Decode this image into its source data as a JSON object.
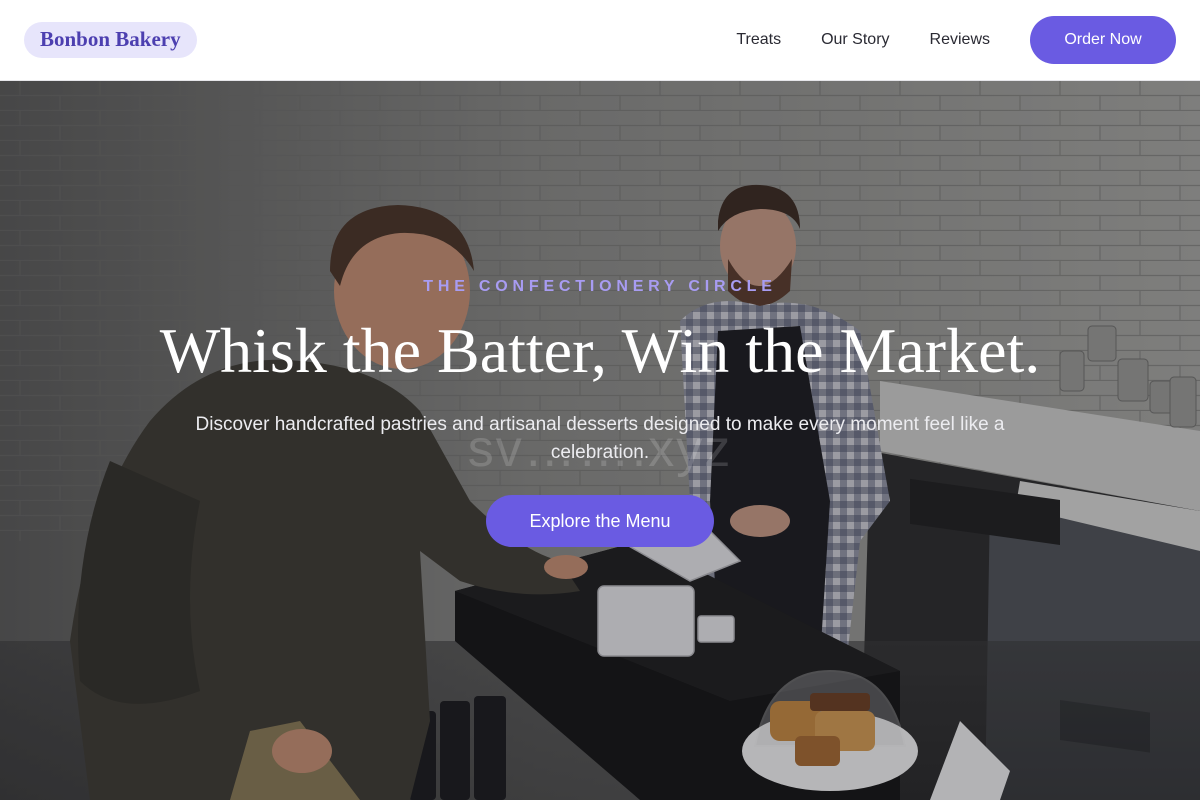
{
  "header": {
    "brand": "Bonbon Bakery",
    "nav": [
      {
        "label": "Treats"
      },
      {
        "label": "Our Story"
      },
      {
        "label": "Reviews"
      }
    ],
    "cta_label": "Order Now"
  },
  "hero": {
    "eyebrow": "THE CONFECTIONERY CIRCLE",
    "headline": "Whisk the Batter, Win the Market.",
    "subhead": "Discover handcrafted pastries and artisanal desserts designed to make every moment feel like a celebration.",
    "cta_label": "Explore the Menu",
    "watermark": "sv…….xyz",
    "image_alt": "photo-customer-and-barista-at-bakery-counter"
  },
  "colors": {
    "accent": "#6a5be2",
    "brand_text": "#4c3fb0",
    "brand_bg": "#e7e5fb",
    "eyebrow": "#a89cf2"
  }
}
